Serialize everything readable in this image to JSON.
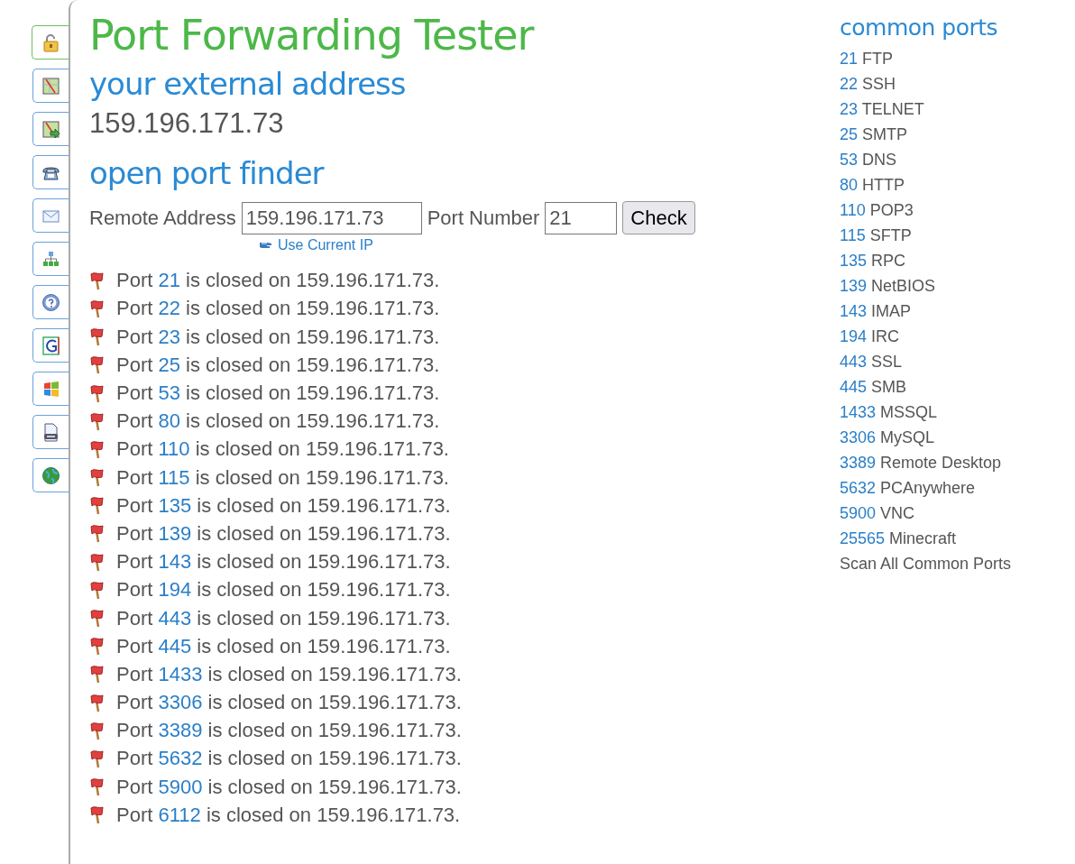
{
  "sidebar": {
    "tabs": [
      {
        "kind": "lock",
        "selected": true
      },
      {
        "kind": "map",
        "selected": false
      },
      {
        "kind": "map-arrow",
        "selected": false
      },
      {
        "kind": "phone",
        "selected": false
      },
      {
        "kind": "mail",
        "selected": false
      },
      {
        "kind": "network",
        "selected": false
      },
      {
        "kind": "help",
        "selected": false
      },
      {
        "kind": "g",
        "selected": false
      },
      {
        "kind": "windows",
        "selected": false
      },
      {
        "kind": "document",
        "selected": false
      },
      {
        "kind": "globe",
        "selected": false
      }
    ]
  },
  "main": {
    "title": "Port Forwarding Tester",
    "external_heading": "your external address",
    "external_ip": "159.196.171.73",
    "finder_heading": "open port finder",
    "form": {
      "remote_label": "Remote Address",
      "remote_value": "159.196.171.73",
      "port_label": "Port Number",
      "port_value": "21",
      "button": "Check",
      "use_current_ip": "Use Current IP"
    },
    "results": [
      {
        "prefix": "Port",
        "port": "21",
        "suffix": "is closed on 159.196.171.73."
      },
      {
        "prefix": "Port",
        "port": "22",
        "suffix": "is closed on 159.196.171.73."
      },
      {
        "prefix": "Port",
        "port": "23",
        "suffix": "is closed on 159.196.171.73."
      },
      {
        "prefix": "Port",
        "port": "25",
        "suffix": "is closed on 159.196.171.73."
      },
      {
        "prefix": "Port",
        "port": "53",
        "suffix": "is closed on 159.196.171.73."
      },
      {
        "prefix": "Port",
        "port": "80",
        "suffix": "is closed on 159.196.171.73."
      },
      {
        "prefix": "Port",
        "port": "110",
        "suffix": "is closed on 159.196.171.73."
      },
      {
        "prefix": "Port",
        "port": "115",
        "suffix": "is closed on 159.196.171.73."
      },
      {
        "prefix": "Port",
        "port": "135",
        "suffix": "is closed on 159.196.171.73."
      },
      {
        "prefix": "Port",
        "port": "139",
        "suffix": "is closed on 159.196.171.73."
      },
      {
        "prefix": "Port",
        "port": "143",
        "suffix": "is closed on 159.196.171.73."
      },
      {
        "prefix": "Port",
        "port": "194",
        "suffix": "is closed on 159.196.171.73."
      },
      {
        "prefix": "Port",
        "port": "443",
        "suffix": "is closed on 159.196.171.73."
      },
      {
        "prefix": "Port",
        "port": "445",
        "suffix": "is closed on 159.196.171.73."
      },
      {
        "prefix": "Port",
        "port": "1433",
        "suffix": "is closed on 159.196.171.73."
      },
      {
        "prefix": "Port",
        "port": "3306",
        "suffix": "is closed on 159.196.171.73."
      },
      {
        "prefix": "Port",
        "port": "3389",
        "suffix": "is closed on 159.196.171.73."
      },
      {
        "prefix": "Port",
        "port": "5632",
        "suffix": "is closed on 159.196.171.73."
      },
      {
        "prefix": "Port",
        "port": "5900",
        "suffix": "is closed on 159.196.171.73."
      },
      {
        "prefix": "Port",
        "port": "6112",
        "suffix": "is closed on 159.196.171.73."
      }
    ]
  },
  "common_ports": {
    "heading": "common ports",
    "items": [
      {
        "port": "21",
        "service": "FTP"
      },
      {
        "port": "22",
        "service": "SSH"
      },
      {
        "port": "23",
        "service": "TELNET"
      },
      {
        "port": "25",
        "service": "SMTP"
      },
      {
        "port": "53",
        "service": "DNS"
      },
      {
        "port": "80",
        "service": "HTTP"
      },
      {
        "port": "110",
        "service": "POP3"
      },
      {
        "port": "115",
        "service": "SFTP"
      },
      {
        "port": "135",
        "service": "RPC"
      },
      {
        "port": "139",
        "service": "NetBIOS"
      },
      {
        "port": "143",
        "service": "IMAP"
      },
      {
        "port": "194",
        "service": "IRC"
      },
      {
        "port": "443",
        "service": "SSL"
      },
      {
        "port": "445",
        "service": "SMB"
      },
      {
        "port": "1433",
        "service": "MSSQL"
      },
      {
        "port": "3306",
        "service": "MySQL"
      },
      {
        "port": "3389",
        "service": "Remote Desktop"
      },
      {
        "port": "5632",
        "service": "PCAnywhere"
      },
      {
        "port": "5900",
        "service": "VNC"
      },
      {
        "port": "25565",
        "service": "Minecraft"
      }
    ],
    "scan_all": "Scan All Common Ports"
  }
}
